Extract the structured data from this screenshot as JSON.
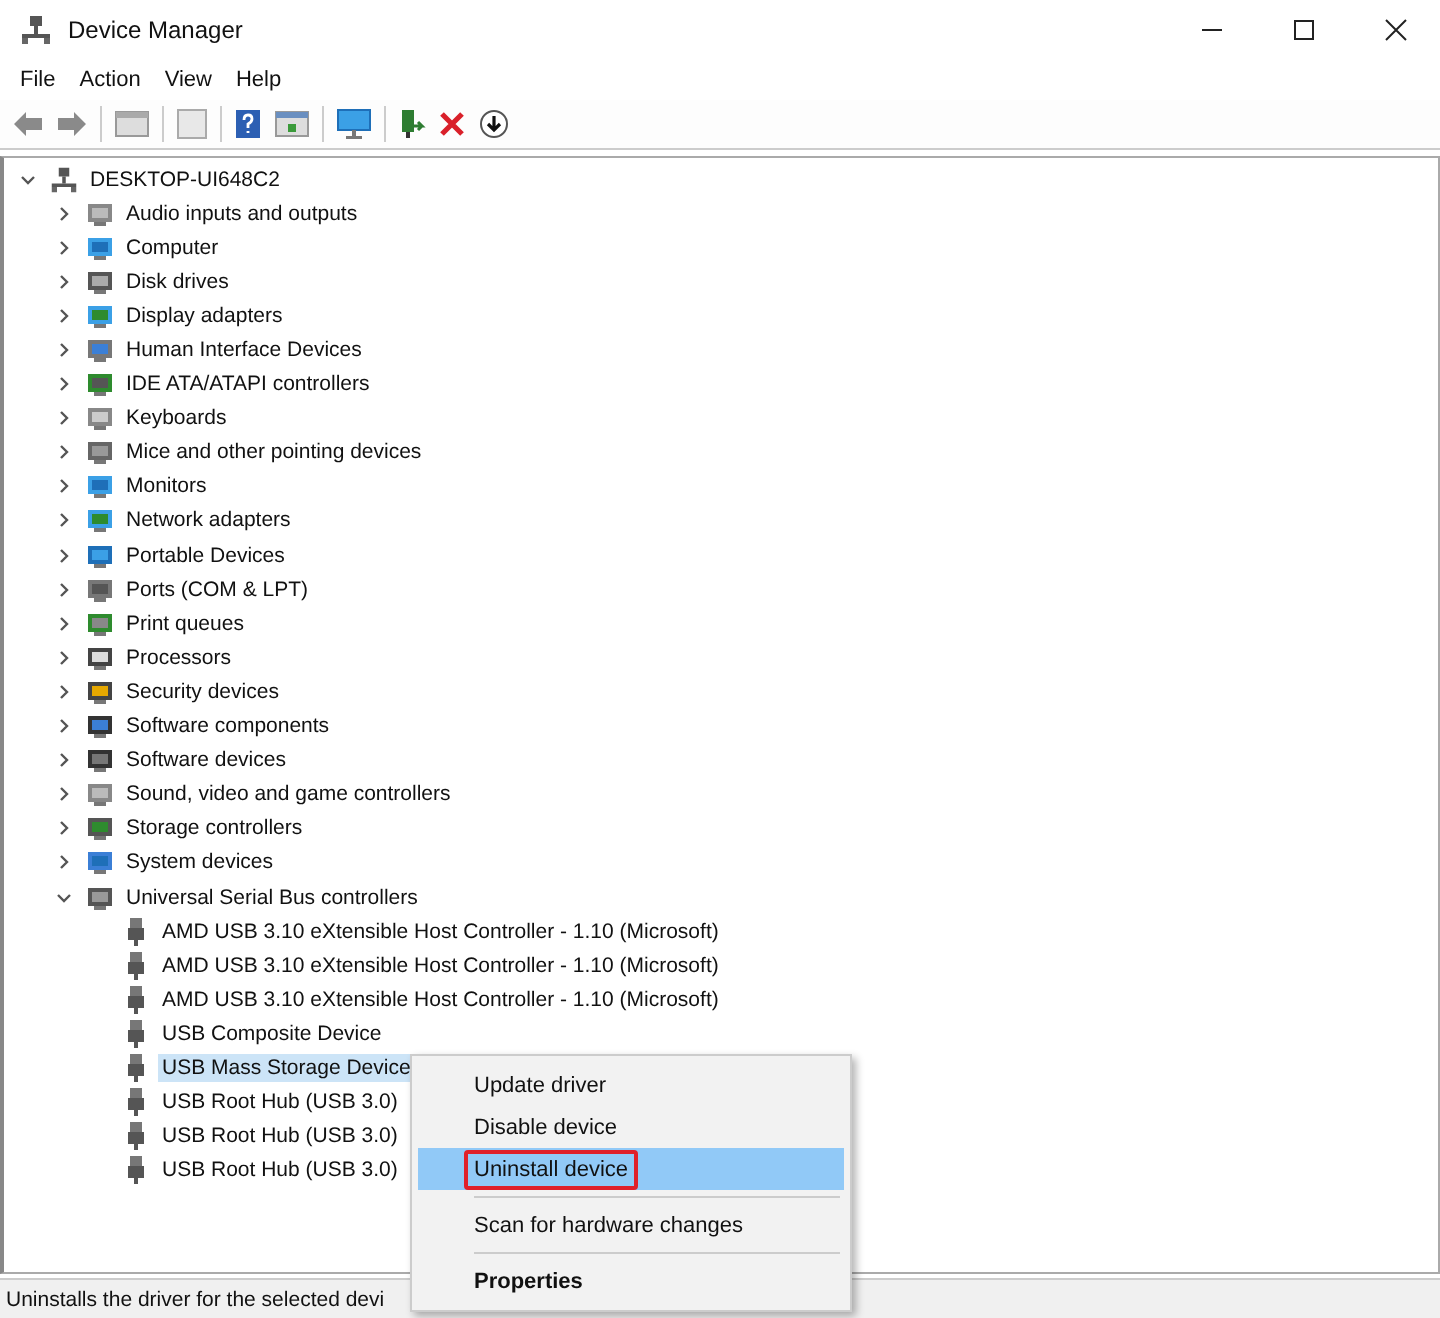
{
  "window": {
    "title": "Device Manager"
  },
  "menu_bar": [
    "File",
    "Action",
    "View",
    "Help"
  ],
  "tree": {
    "label": "DESKTOP-UI648C2",
    "expanded": true,
    "selected": false,
    "children": [
      {
        "label": "Audio inputs and outputs",
        "expanded": false,
        "selected": false
      },
      {
        "label": "Computer",
        "expanded": false,
        "selected": false
      },
      {
        "label": "Disk drives",
        "expanded": false,
        "selected": false
      },
      {
        "label": "Display adapters",
        "expanded": false,
        "selected": false
      },
      {
        "label": "Human Interface Devices",
        "expanded": false,
        "selected": false
      },
      {
        "label": "IDE ATA/ATAPI controllers",
        "expanded": false,
        "selected": false
      },
      {
        "label": "Keyboards",
        "expanded": false,
        "selected": false
      },
      {
        "label": "Mice and other pointing devices",
        "expanded": false,
        "selected": false
      },
      {
        "label": "Monitors",
        "expanded": false,
        "selected": false
      },
      {
        "label": "Network adapters",
        "expanded": false,
        "selected": false
      },
      {
        "label": "Portable Devices",
        "expanded": false,
        "selected": false
      },
      {
        "label": "Ports (COM & LPT)",
        "expanded": false,
        "selected": false
      },
      {
        "label": "Print queues",
        "expanded": false,
        "selected": false
      },
      {
        "label": "Processors",
        "expanded": false,
        "selected": false
      },
      {
        "label": "Security devices",
        "expanded": false,
        "selected": false
      },
      {
        "label": "Software components",
        "expanded": false,
        "selected": false
      },
      {
        "label": "Software devices",
        "expanded": false,
        "selected": false
      },
      {
        "label": "Sound, video and game controllers",
        "expanded": false,
        "selected": false
      },
      {
        "label": "Storage controllers",
        "expanded": false,
        "selected": false
      },
      {
        "label": "System devices",
        "expanded": false,
        "selected": false
      },
      {
        "label": "Universal Serial Bus controllers",
        "expanded": true,
        "selected": false,
        "children": [
          {
            "label": "AMD USB 3.10 eXtensible Host Controller - 1.10 (Microsoft)",
            "selected": false
          },
          {
            "label": "AMD USB 3.10 eXtensible Host Controller - 1.10 (Microsoft)",
            "selected": false
          },
          {
            "label": "AMD USB 3.10 eXtensible Host Controller - 1.10 (Microsoft)",
            "selected": false
          },
          {
            "label": "USB Composite Device",
            "selected": false
          },
          {
            "label": "USB Mass Storage Device",
            "selected": true
          },
          {
            "label": "USB Root Hub (USB 3.0)",
            "selected": false
          },
          {
            "label": "USB Root Hub (USB 3.0)",
            "selected": false
          },
          {
            "label": "USB Root Hub (USB 3.0)",
            "selected": false
          }
        ]
      }
    ]
  },
  "context_menu": [
    {
      "kind": "item",
      "label": "Update driver",
      "selected": false,
      "annotated": false
    },
    {
      "kind": "item",
      "label": "Disable device",
      "selected": false,
      "annotated": false
    },
    {
      "kind": "item",
      "label": "Uninstall device",
      "selected": true,
      "annotated": true
    },
    {
      "kind": "separator"
    },
    {
      "kind": "item",
      "label": "Scan for hardware changes",
      "selected": false,
      "annotated": false
    },
    {
      "kind": "separator"
    },
    {
      "kind": "default",
      "label": "Properties",
      "selected": false,
      "annotated": false
    }
  ],
  "status_bar": "Uninstalls the driver for the selected devi"
}
